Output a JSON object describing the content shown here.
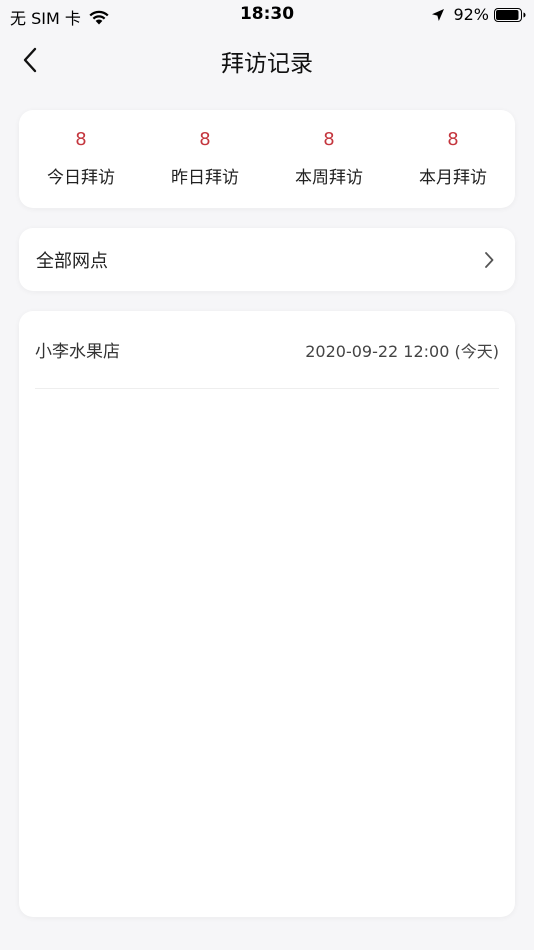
{
  "status_bar": {
    "carrier": "无 SIM 卡",
    "time": "18:30",
    "battery": "92%"
  },
  "nav": {
    "title": "拜访记录"
  },
  "stats": [
    {
      "value": "8",
      "label": "今日拜访"
    },
    {
      "value": "8",
      "label": "昨日拜访"
    },
    {
      "value": "8",
      "label": "本周拜访"
    },
    {
      "value": "8",
      "label": "本月拜访"
    }
  ],
  "filter": {
    "label": "全部网点"
  },
  "records": [
    {
      "name": "小李水果店",
      "time": "2020-09-22 12:00 (今天)"
    }
  ],
  "colors": {
    "accent": "#c4353d",
    "background": "#f6f6f8",
    "card": "#ffffff"
  },
  "icons": {
    "back": "chevron-left-icon",
    "filter_arrow": "chevron-right-icon",
    "wifi": "wifi-icon",
    "location": "location-arrow-icon",
    "battery": "battery-icon"
  }
}
